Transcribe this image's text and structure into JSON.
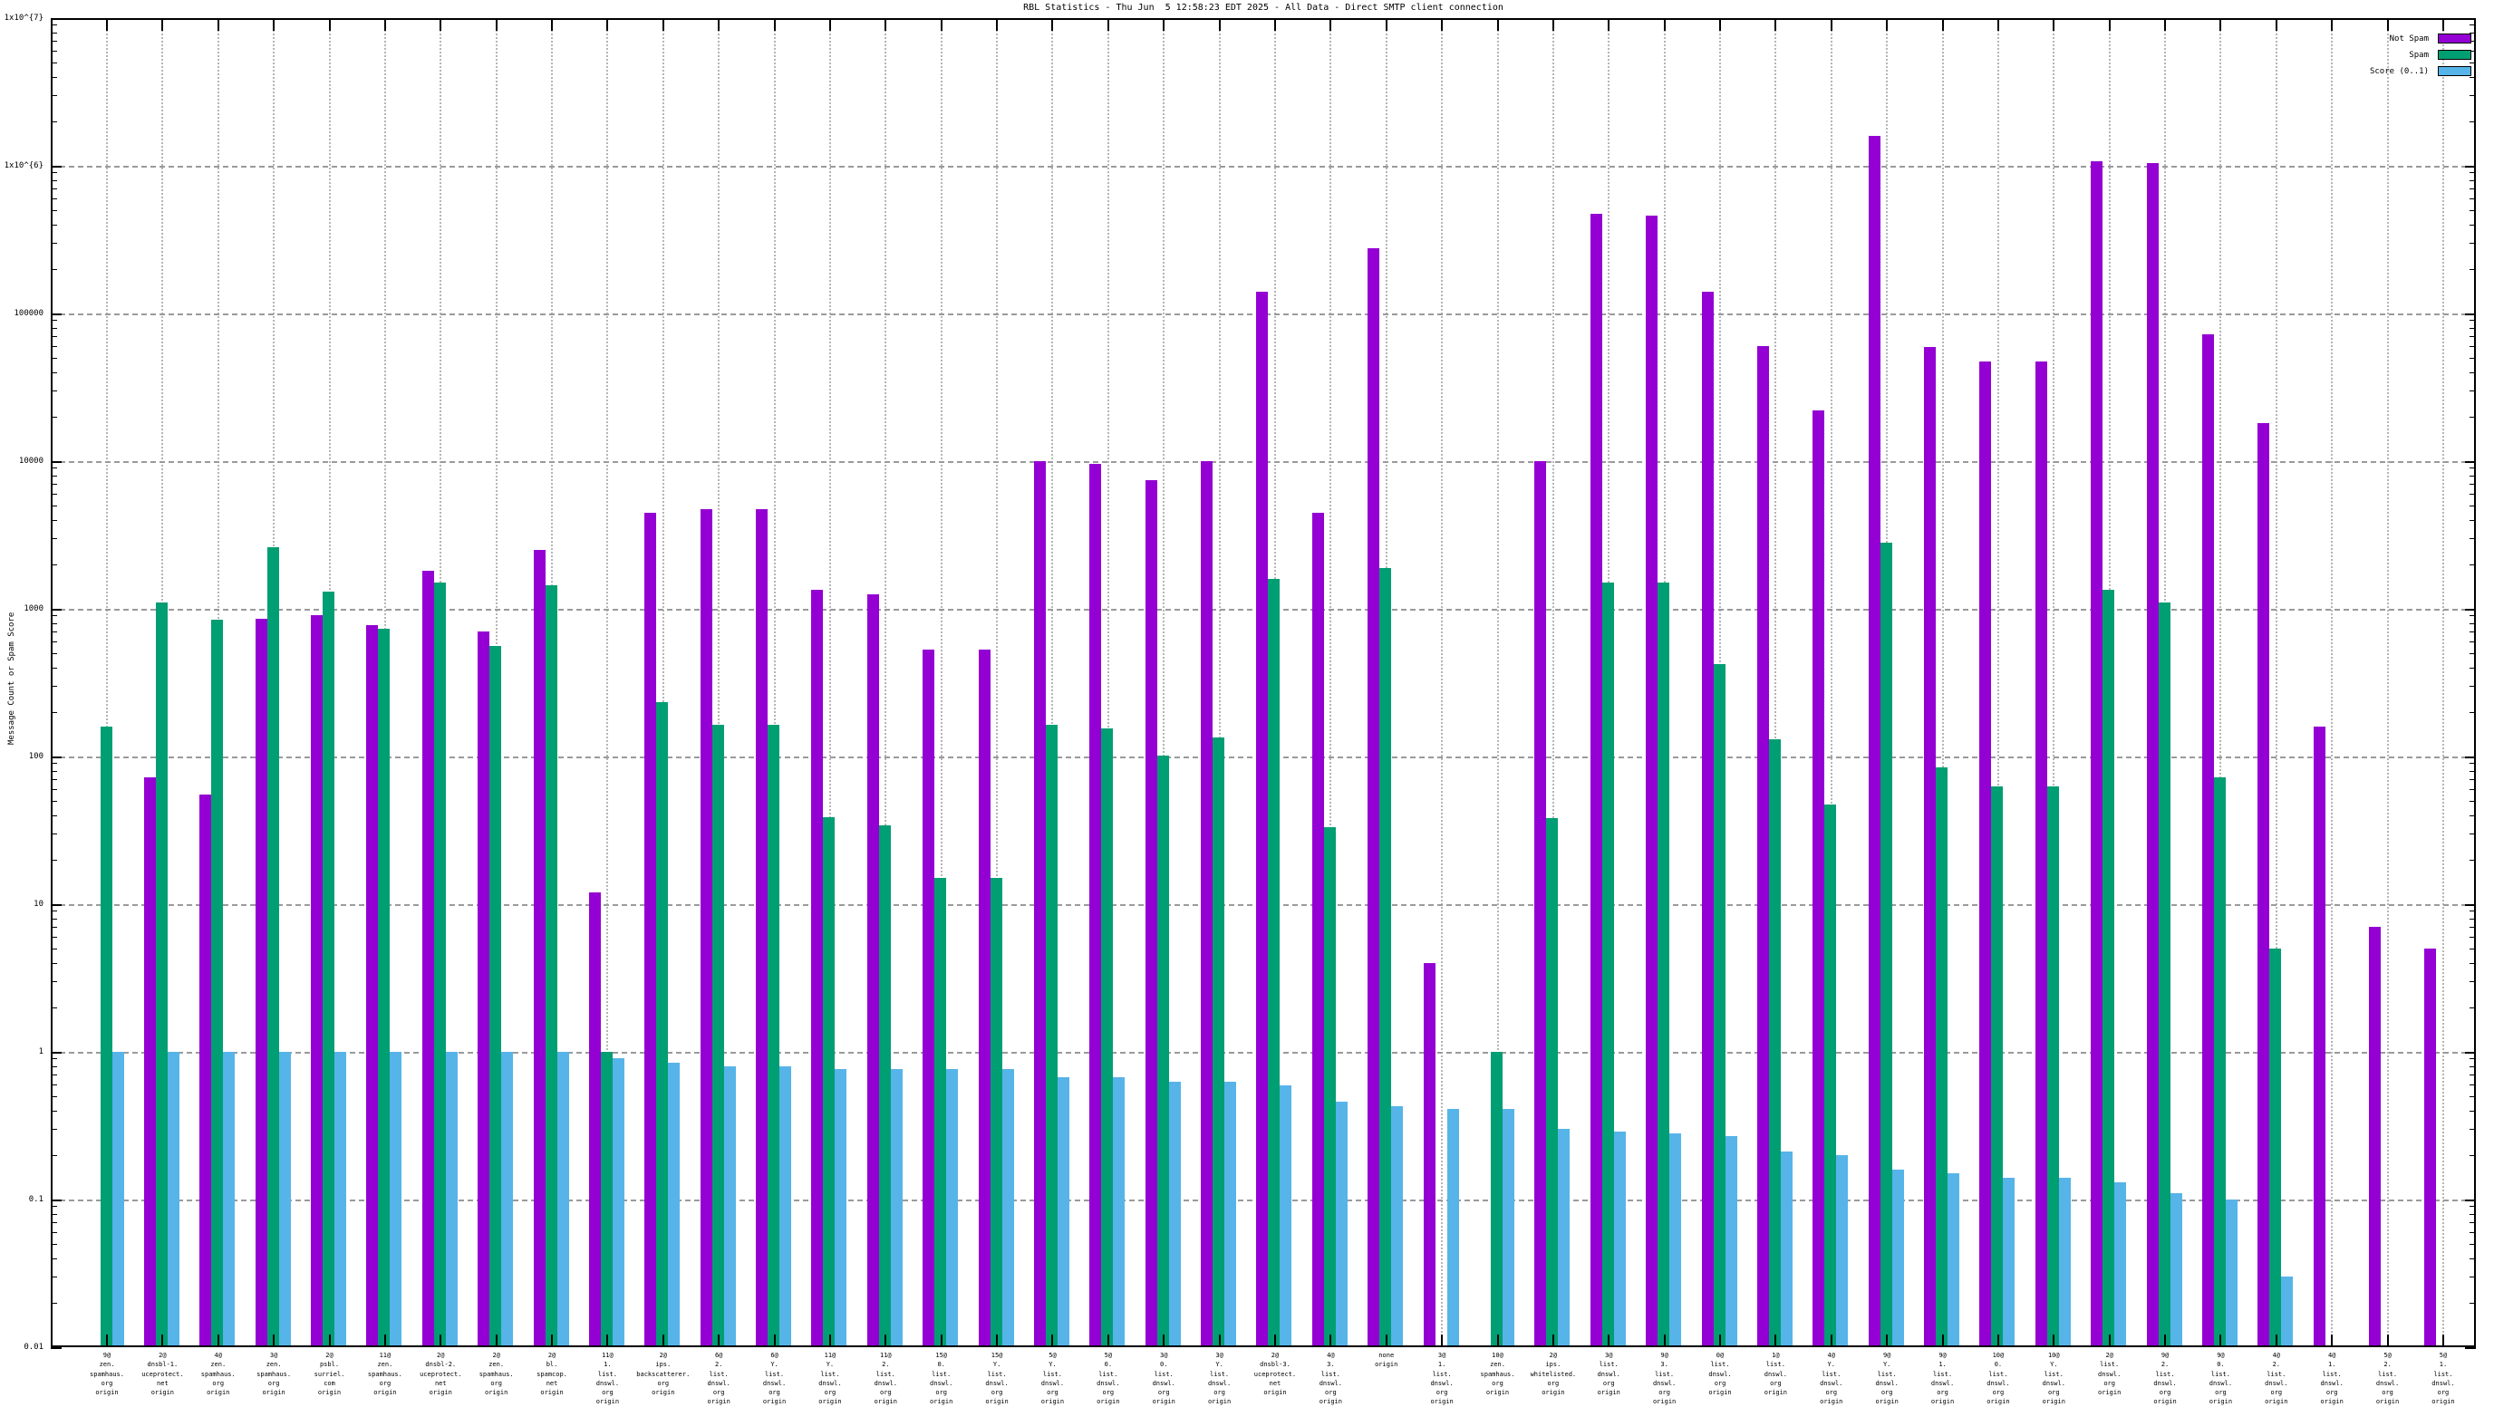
{
  "page": {
    "title": "RBL Statistics - Thu Jun  5 12:58:23 EDT 2025 - All Data - Direct SMTP client connection"
  },
  "chart_data": {
    "type": "bar",
    "title": "RBL Statistics - Thu Jun  5 12:58:23 EDT 2025 - All Data - Direct SMTP client connection",
    "xlabel": "",
    "ylabel": "Message Count or Spam Score",
    "y_scale": "log",
    "ylim": [
      0.01,
      10000000
    ],
    "grid": true,
    "legend_position": "top-right",
    "background": "#ffffff",
    "y_ticks": [
      {
        "label": "1x10^{7}",
        "value": 10000000
      },
      {
        "label": "1x10^{6}",
        "value": 1000000
      },
      {
        "label": "100000",
        "value": 100000
      },
      {
        "label": "10000",
        "value": 10000
      },
      {
        "label": "1000",
        "value": 1000
      },
      {
        "label": "100",
        "value": 100
      },
      {
        "label": "10",
        "value": 10
      },
      {
        "label": "1",
        "value": 1
      },
      {
        "label": "0.1",
        "value": 0.1
      },
      {
        "label": "0.01",
        "value": 0.01
      }
    ],
    "series": [
      {
        "name": "Not Spam",
        "key": "not_spam",
        "color": "#9400d3"
      },
      {
        "name": "Spam",
        "key": "spam",
        "color": "#009e73"
      },
      {
        "name": "Score (0..1)",
        "key": "score",
        "color": "#56b4e9"
      }
    ],
    "groups": [
      {
        "label_lines": [
          "9@",
          "zen.",
          "spamhaus.",
          "org",
          "origin"
        ],
        "not_spam": null,
        "spam": 160,
        "score": 1.0
      },
      {
        "label_lines": [
          "2@",
          "dnsbl-1.",
          "uceprotect.",
          "net",
          "origin"
        ],
        "not_spam": 72,
        "spam": 1100,
        "score": 1.0
      },
      {
        "label_lines": [
          "4@",
          "zen.",
          "spamhaus.",
          "org",
          "origin"
        ],
        "not_spam": 55,
        "spam": 850,
        "score": 1.0
      },
      {
        "label_lines": [
          "3@",
          "zen.",
          "spamhaus.",
          "org",
          "origin"
        ],
        "not_spam": 860,
        "spam": 2600,
        "score": 1.0
      },
      {
        "label_lines": [
          "2@",
          "psbl.",
          "surriel.",
          "com",
          "origin"
        ],
        "not_spam": 910,
        "spam": 1300,
        "score": 1.0
      },
      {
        "label_lines": [
          "11@",
          "zen.",
          "spamhaus.",
          "org",
          "origin"
        ],
        "not_spam": 780,
        "spam": 730,
        "score": 1.0
      },
      {
        "label_lines": [
          "2@",
          "dnsbl-2.",
          "uceprotect.",
          "net",
          "origin"
        ],
        "not_spam": 1800,
        "spam": 1500,
        "score": 1.0
      },
      {
        "label_lines": [
          "2@",
          "zen.",
          "spamhaus.",
          "org",
          "origin"
        ],
        "not_spam": 700,
        "spam": 560,
        "score": 1.0
      },
      {
        "label_lines": [
          "2@",
          "bl.",
          "spamcop.",
          "net",
          "origin"
        ],
        "not_spam": 2500,
        "spam": 1450,
        "score": 1.0
      },
      {
        "label_lines": [
          "11@",
          "1.",
          "list.",
          "dnswl.",
          "org",
          "origin"
        ],
        "not_spam": 12,
        "spam": 1.0,
        "score": 0.9
      },
      {
        "label_lines": [
          "2@",
          "ips.",
          "backscatterer.",
          "org",
          "origin"
        ],
        "not_spam": 4500,
        "spam": 235,
        "score": 0.85
      },
      {
        "label_lines": [
          "6@",
          "2.",
          "list.",
          "dnswl.",
          "org",
          "origin"
        ],
        "not_spam": 4700,
        "spam": 165,
        "score": 0.8
      },
      {
        "label_lines": [
          "6@",
          "Y.",
          "list.",
          "dnswl.",
          "org",
          "origin"
        ],
        "not_spam": 4700,
        "spam": 165,
        "score": 0.8
      },
      {
        "label_lines": [
          "11@",
          "Y.",
          "list.",
          "dnswl.",
          "org",
          "origin"
        ],
        "not_spam": 1350,
        "spam": 39,
        "score": 0.77
      },
      {
        "label_lines": [
          "11@",
          "2.",
          "list.",
          "dnswl.",
          "org",
          "origin"
        ],
        "not_spam": 1250,
        "spam": 34,
        "score": 0.76
      },
      {
        "label_lines": [
          "15@",
          "0.",
          "list.",
          "dnswl.",
          "org",
          "origin"
        ],
        "not_spam": 530,
        "spam": 15,
        "score": 0.77
      },
      {
        "label_lines": [
          "15@",
          "Y.",
          "list.",
          "dnswl.",
          "org",
          "origin"
        ],
        "not_spam": 530,
        "spam": 15,
        "score": 0.77
      },
      {
        "label_lines": [
          "5@",
          "Y.",
          "list.",
          "dnswl.",
          "org",
          "origin"
        ],
        "not_spam": 10000,
        "spam": 165,
        "score": 0.67
      },
      {
        "label_lines": [
          "5@",
          "0.",
          "list.",
          "dnswl.",
          "org",
          "origin"
        ],
        "not_spam": 9600,
        "spam": 155,
        "score": 0.67
      },
      {
        "label_lines": [
          "3@",
          "0.",
          "list.",
          "dnswl.",
          "org",
          "origin"
        ],
        "not_spam": 7400,
        "spam": 102,
        "score": 0.63
      },
      {
        "label_lines": [
          "3@",
          "Y.",
          "list.",
          "dnswl.",
          "org",
          "origin"
        ],
        "not_spam": 10000,
        "spam": 135,
        "score": 0.63
      },
      {
        "label_lines": [
          "2@",
          "dnsbl-3.",
          "uceprotect.",
          "net",
          "origin"
        ],
        "not_spam": 140000,
        "spam": 1600,
        "score": 0.59
      },
      {
        "label_lines": [
          "4@",
          "3.",
          "list.",
          "dnswl.",
          "org",
          "origin"
        ],
        "not_spam": 4500,
        "spam": 33,
        "score": 0.46
      },
      {
        "label_lines": [
          "none",
          "origin"
        ],
        "not_spam": 275000,
        "spam": 1900,
        "score": 0.43
      },
      {
        "label_lines": [
          "3@",
          "1.",
          "list.",
          "dnswl.",
          "org",
          "origin"
        ],
        "not_spam": 4,
        "spam": null,
        "score": 0.41
      },
      {
        "label_lines": [
          "10@",
          "zen.",
          "spamhaus.",
          "org",
          "origin"
        ],
        "not_spam": null,
        "spam": 1.0,
        "score": 0.41
      },
      {
        "label_lines": [
          "2@",
          "ips.",
          "whitelisted.",
          "org",
          "origin"
        ],
        "not_spam": 10000,
        "spam": 38,
        "score": 0.3
      },
      {
        "label_lines": [
          "3@",
          "list.",
          "dnswl.",
          "org",
          "origin"
        ],
        "not_spam": 470000,
        "spam": 1500,
        "score": 0.29
      },
      {
        "label_lines": [
          "9@",
          "3.",
          "list.",
          "dnswl.",
          "org",
          "origin"
        ],
        "not_spam": 460000,
        "spam": 1500,
        "score": 0.28
      },
      {
        "label_lines": [
          "0@",
          "list.",
          "dnswl.",
          "org",
          "origin"
        ],
        "not_spam": 140000,
        "spam": 420,
        "score": 0.27
      },
      {
        "label_lines": [
          "1@",
          "list.",
          "dnswl.",
          "org",
          "origin"
        ],
        "not_spam": 60000,
        "spam": 130,
        "score": 0.21
      },
      {
        "label_lines": [
          "4@",
          "Y.",
          "list.",
          "dnswl.",
          "org",
          "origin"
        ],
        "not_spam": 22000,
        "spam": 47,
        "score": 0.2
      },
      {
        "label_lines": [
          "9@",
          "Y.",
          "list.",
          "dnswl.",
          "org",
          "origin"
        ],
        "not_spam": 1600000,
        "spam": 2800,
        "score": 0.16
      },
      {
        "label_lines": [
          "9@",
          "1.",
          "list.",
          "dnswl.",
          "org",
          "origin"
        ],
        "not_spam": 59000,
        "spam": 85,
        "score": 0.15
      },
      {
        "label_lines": [
          "10@",
          "0.",
          "list.",
          "dnswl.",
          "org",
          "origin"
        ],
        "not_spam": 47000,
        "spam": 63,
        "score": 0.14
      },
      {
        "label_lines": [
          "10@",
          "Y.",
          "list.",
          "dnswl.",
          "org",
          "origin"
        ],
        "not_spam": 47000,
        "spam": 63,
        "score": 0.14
      },
      {
        "label_lines": [
          "2@",
          "list.",
          "dnswl.",
          "org",
          "origin"
        ],
        "not_spam": 1070000,
        "spam": 1350,
        "score": 0.13
      },
      {
        "label_lines": [
          "9@",
          "2.",
          "list.",
          "dnswl.",
          "org",
          "origin"
        ],
        "not_spam": 1040000,
        "spam": 1100,
        "score": 0.11
      },
      {
        "label_lines": [
          "9@",
          "0.",
          "list.",
          "dnswl.",
          "org",
          "origin"
        ],
        "not_spam": 72000,
        "spam": 72,
        "score": 0.1
      },
      {
        "label_lines": [
          "4@",
          "2.",
          "list.",
          "dnswl.",
          "org",
          "origin"
        ],
        "not_spam": 18000,
        "spam": 5,
        "score": 0.03
      },
      {
        "label_lines": [
          "4@",
          "1.",
          "list.",
          "dnswl.",
          "org",
          "origin"
        ],
        "not_spam": 160,
        "spam": null,
        "score": null
      },
      {
        "label_lines": [
          "5@",
          "2.",
          "list.",
          "dnswl.",
          "org",
          "origin"
        ],
        "not_spam": 7,
        "spam": null,
        "score": null
      },
      {
        "label_lines": [
          "5@",
          "1.",
          "list.",
          "dnswl.",
          "org",
          "origin"
        ],
        "not_spam": 5,
        "spam": null,
        "score": null
      }
    ]
  }
}
